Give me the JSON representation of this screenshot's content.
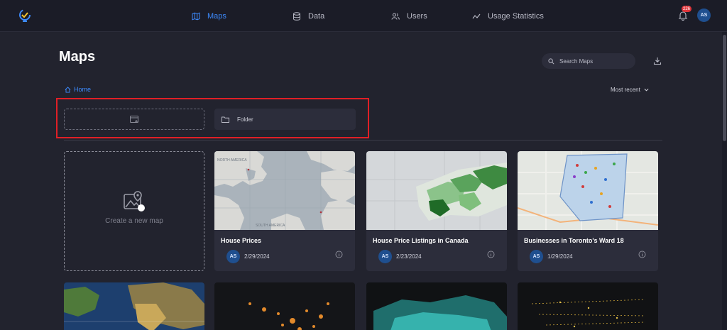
{
  "nav": {
    "items": [
      {
        "label": "Maps",
        "icon": "map-icon",
        "active": true
      },
      {
        "label": "Data",
        "icon": "database-icon",
        "active": false
      },
      {
        "label": "Users",
        "icon": "users-icon",
        "active": false
      },
      {
        "label": "Usage Statistics",
        "icon": "trend-icon",
        "active": false
      }
    ],
    "notification_count": "226",
    "user_initials": "AS"
  },
  "page": {
    "title": "Maps",
    "search_placeholder": "Search Maps",
    "breadcrumb": "Home",
    "sort_label": "Most recent"
  },
  "folders": {
    "items": [
      {
        "name": "Folder"
      }
    ]
  },
  "create_map": {
    "label": "Create a new map"
  },
  "maps": [
    {
      "title": "House Prices",
      "owner": "AS",
      "date": "2/29/2024",
      "thumb": "world-light-map"
    },
    {
      "title": "House Price Listings in Canada",
      "owner": "AS",
      "date": "2/23/2024",
      "thumb": "toronto-green-map"
    },
    {
      "title": "Businesses in Toronto's Ward 18",
      "owner": "AS",
      "date": "1/29/2024",
      "thumb": "toronto-ward-map"
    },
    {
      "title": "",
      "owner": "",
      "date": "",
      "thumb": "satellite-world-map"
    },
    {
      "title": "",
      "owner": "",
      "date": "",
      "thumb": "dark-orange-dots-map"
    },
    {
      "title": "",
      "owner": "",
      "date": "",
      "thumb": "dark-cyan-map"
    },
    {
      "title": "",
      "owner": "",
      "date": "",
      "thumb": "dark-yellow-map"
    }
  ],
  "thumb_labels": {
    "north_america": "NORTH AMERICA",
    "south_america": "SOUTH AMERICA"
  },
  "colors": {
    "accent": "#3d8bff",
    "background": "#22232e",
    "card": "#2c2d3b",
    "highlight": "#e01f26",
    "badge": "#e0363c"
  }
}
